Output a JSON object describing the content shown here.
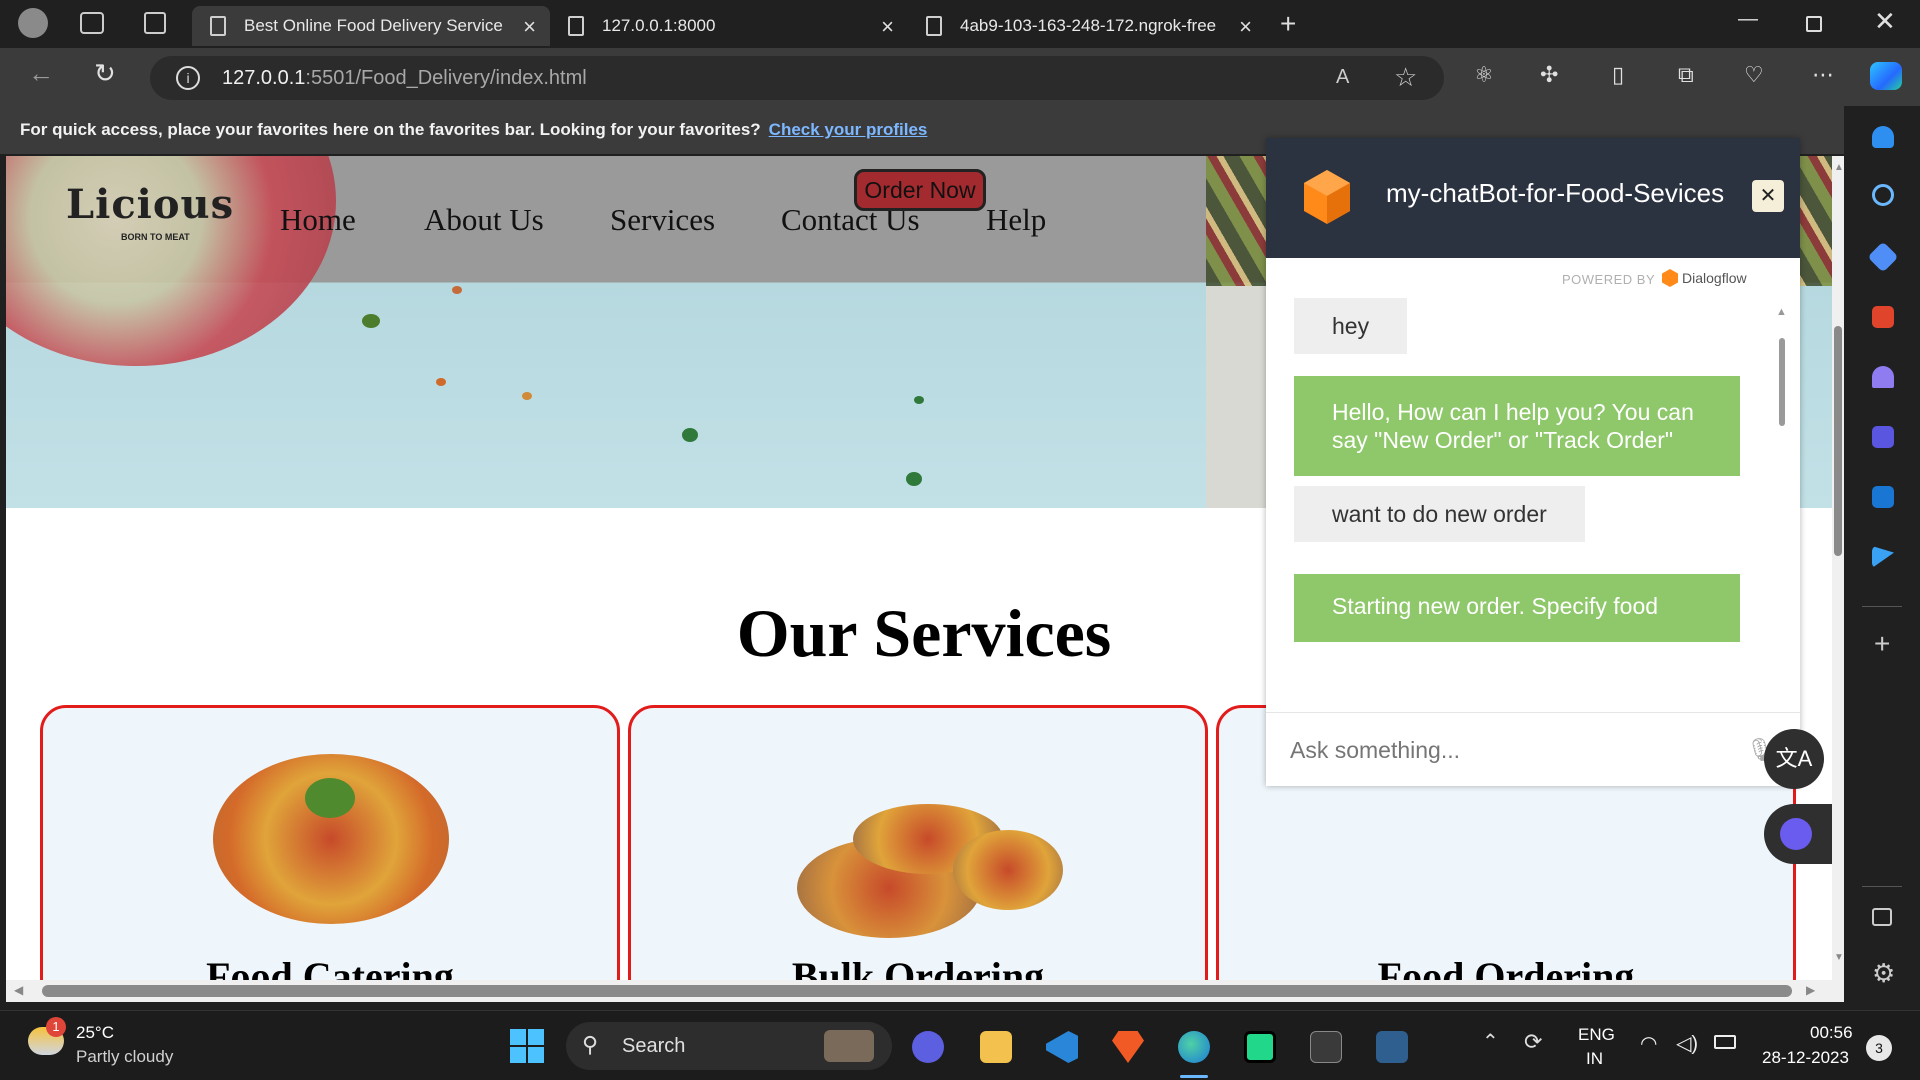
{
  "tabs": [
    {
      "label": "Best Online Food Delivery Service"
    },
    {
      "label": "127.0.0.1:8000"
    },
    {
      "label": "4ab9-103-163-248-172.ngrok-free"
    }
  ],
  "address": {
    "host": "127.0.0.1",
    "path": ":5501/Food_Delivery/index.html"
  },
  "favorites_bar": {
    "text": "For quick access, place your favorites here on the favorites bar. Looking for your favorites?",
    "link": "Check your profiles"
  },
  "site": {
    "logo": "Licious",
    "logo_tagline": "BORN TO MEAT",
    "nav": [
      "Home",
      "About Us",
      "Services",
      "Contact Us",
      "Help"
    ],
    "order_button": "Order Now",
    "services_title": "Our Services",
    "cards": [
      "Food Catering",
      "Bulk Ordering",
      "Food Ordering"
    ]
  },
  "chatbot": {
    "title": "my-chatBot-for-Food-Sevices",
    "close": "✕",
    "powered_by": "POWERED BY",
    "provider": "Dialogflow",
    "messages": [
      {
        "from": "user",
        "text": "hey"
      },
      {
        "from": "bot",
        "text": "Hello, How can I help you? You can say \"New Order\" or \"Track Order\""
      },
      {
        "from": "user",
        "text": "want to do new order"
      },
      {
        "from": "bot",
        "text": "Starting new order. Specify food"
      }
    ],
    "input_placeholder": "Ask something..."
  },
  "taskbar": {
    "weather_temp": "25°C",
    "weather_desc": "Partly cloudy",
    "weather_badge": "1",
    "search": "Search",
    "lang_top": "ENG",
    "lang_bottom": "IN",
    "time": "00:56",
    "date": "28-12-2023",
    "notifications": "3"
  },
  "colors": {
    "card_border": "#e21b1b",
    "bot_bubble": "#8ec86a",
    "chat_header": "#2b3240",
    "order_button": "#a32a2f"
  }
}
